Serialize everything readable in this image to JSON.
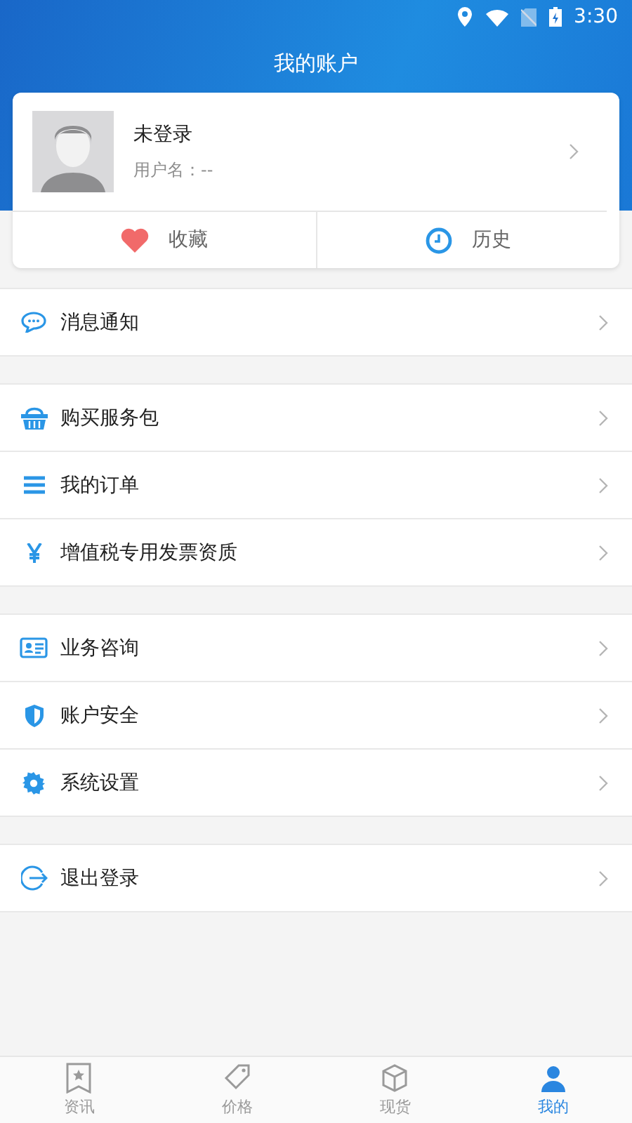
{
  "status_bar": {
    "time": "3:30"
  },
  "title": "我的账户",
  "profile": {
    "name": "未登录",
    "username": "用户名：--"
  },
  "shortcuts": [
    {
      "label": "收藏"
    },
    {
      "label": "历史"
    }
  ],
  "groups": [
    [
      {
        "label": "消息通知"
      }
    ],
    [
      {
        "label": "购买服务包"
      },
      {
        "label": "我的订单"
      },
      {
        "label": "增值税专用发票资质"
      }
    ],
    [
      {
        "label": "业务咨询"
      },
      {
        "label": "账户安全"
      },
      {
        "label": "系统设置"
      }
    ],
    [
      {
        "label": "退出登录"
      }
    ]
  ],
  "tabs": [
    {
      "label": "资讯",
      "selected": false
    },
    {
      "label": "价格",
      "selected": false
    },
    {
      "label": "现货",
      "selected": false
    },
    {
      "label": "我的",
      "selected": true
    }
  ]
}
